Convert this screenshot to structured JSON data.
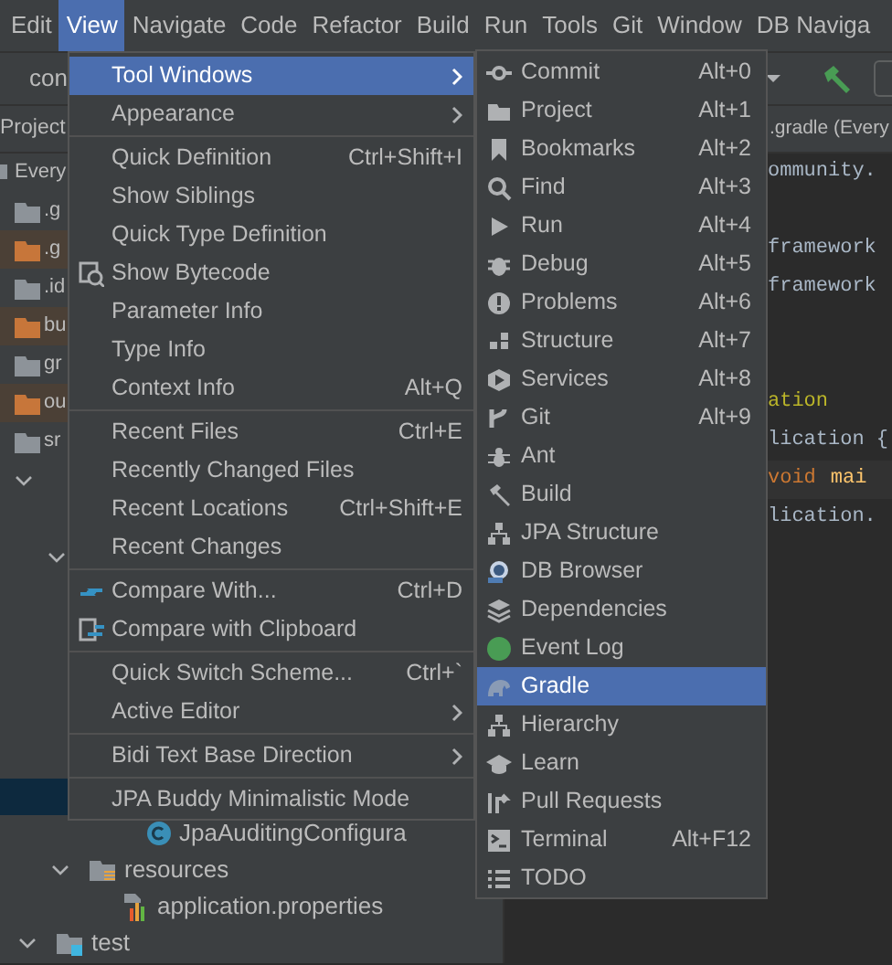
{
  "menubar": [
    {
      "label": "Edit",
      "selected": false
    },
    {
      "label": "View",
      "selected": true
    },
    {
      "label": "Navigate",
      "selected": false
    },
    {
      "label": "Code",
      "selected": false
    },
    {
      "label": "Refactor",
      "selected": false
    },
    {
      "label": "Build",
      "selected": false
    },
    {
      "label": "Run",
      "selected": false
    },
    {
      "label": "Tools",
      "selected": false
    },
    {
      "label": "Git",
      "selected": false
    },
    {
      "label": "Window",
      "selected": false
    },
    {
      "label": "DB Naviga",
      "selected": false
    }
  ],
  "breadcrumb": "con",
  "project_panel": {
    "title": "Project",
    "tree_top": [
      {
        "label": "Every",
        "kind": "module",
        "ignored": false
      },
      {
        "label": ".g",
        "kind": "folder",
        "ignored": false
      },
      {
        "label": ".g",
        "kind": "folder",
        "ignored": true
      },
      {
        "label": ".id",
        "kind": "folder",
        "ignored": false
      },
      {
        "label": "bu",
        "kind": "folder",
        "ignored": true
      },
      {
        "label": "gr",
        "kind": "folder",
        "ignored": false
      },
      {
        "label": "ou",
        "kind": "folder",
        "ignored": true
      },
      {
        "label": "sr",
        "kind": "folder",
        "ignored": false
      }
    ],
    "tree_bottom": [
      {
        "label": "JpaAuditingConfigura",
        "kind": "class"
      },
      {
        "label": "resources",
        "kind": "resources",
        "children": [
          {
            "label": "application.properties",
            "kind": "properties"
          }
        ]
      },
      {
        "label": "test",
        "kind": "test"
      }
    ]
  },
  "editor": {
    "tab": ".gradle (Every",
    "lines": [
      {
        "text": "ommunity.",
        "kind": "plain"
      },
      {
        "kind": "blank"
      },
      {
        "text": "framework",
        "kind": "plain"
      },
      {
        "text": "framework",
        "kind": "plain"
      },
      {
        "kind": "blank"
      },
      {
        "kind": "blank"
      },
      {
        "text": "ation",
        "kind": "annotation"
      },
      {
        "text": "lication {",
        "kind": "plain"
      },
      {
        "text": "void",
        "kind": "keyword",
        "rest": "mai"
      },
      {
        "text": "lication.",
        "kind": "plain"
      }
    ]
  },
  "view_menu": [
    {
      "kind": "submenu",
      "label": "Tool Windows",
      "selected": true
    },
    {
      "kind": "submenu",
      "label": "Appearance",
      "selected": false
    },
    {
      "kind": "separator"
    },
    {
      "kind": "item",
      "label": "Quick Definition",
      "shortcut": "Ctrl+Shift+I",
      "selected": false
    },
    {
      "kind": "item",
      "label": "Show Siblings",
      "selected": false
    },
    {
      "kind": "item",
      "label": "Quick Type Definition",
      "selected": false
    },
    {
      "kind": "item",
      "label": "Show Bytecode",
      "selected": false
    },
    {
      "kind": "item",
      "label": "Parameter Info",
      "selected": false
    },
    {
      "kind": "item",
      "label": "Type Info",
      "selected": false
    },
    {
      "kind": "item",
      "label": "Context Info",
      "shortcut": "Alt+Q",
      "selected": false
    },
    {
      "kind": "separator"
    },
    {
      "kind": "item",
      "label": "Recent Files",
      "shortcut": "Ctrl+E",
      "selected": false
    },
    {
      "kind": "item",
      "label": "Recently Changed Files",
      "selected": false
    },
    {
      "kind": "item",
      "label": "Recent Locations",
      "shortcut": "Ctrl+Shift+E",
      "selected": false
    },
    {
      "kind": "item",
      "label": "Recent Changes",
      "selected": false
    },
    {
      "kind": "separator"
    },
    {
      "kind": "item",
      "label": "Compare With...",
      "shortcut": "Ctrl+D",
      "selected": false
    },
    {
      "kind": "item",
      "label": "Compare with Clipboard",
      "selected": false
    },
    {
      "kind": "separator"
    },
    {
      "kind": "item",
      "label": "Quick Switch Scheme...",
      "shortcut": "Ctrl+`",
      "selected": false
    },
    {
      "kind": "submenu",
      "label": "Active Editor",
      "selected": false
    },
    {
      "kind": "separator"
    },
    {
      "kind": "submenu",
      "label": "Bidi Text Base Direction",
      "selected": false
    },
    {
      "kind": "separator"
    },
    {
      "kind": "item",
      "label": "JPA Buddy Minimalistic Mode",
      "selected": false
    }
  ],
  "tool_windows_menu": [
    {
      "label": "Commit",
      "shortcut": "Alt+0",
      "selected": false
    },
    {
      "label": "Project",
      "shortcut": "Alt+1",
      "selected": false
    },
    {
      "label": "Bookmarks",
      "shortcut": "Alt+2",
      "selected": false
    },
    {
      "label": "Find",
      "shortcut": "Alt+3",
      "selected": false
    },
    {
      "label": "Run",
      "shortcut": "Alt+4",
      "selected": false
    },
    {
      "label": "Debug",
      "shortcut": "Alt+5",
      "selected": false
    },
    {
      "label": "Problems",
      "shortcut": "Alt+6",
      "selected": false
    },
    {
      "label": "Structure",
      "shortcut": "Alt+7",
      "selected": false
    },
    {
      "label": "Services",
      "shortcut": "Alt+8",
      "selected": false
    },
    {
      "label": "Git",
      "shortcut": "Alt+9",
      "selected": false
    },
    {
      "label": "Ant",
      "selected": false
    },
    {
      "label": "Build",
      "selected": false
    },
    {
      "label": "JPA Structure",
      "selected": false
    },
    {
      "label": "DB Browser",
      "selected": false
    },
    {
      "label": "Dependencies",
      "selected": false
    },
    {
      "label": "Event Log",
      "selected": false
    },
    {
      "label": "Gradle",
      "selected": true
    },
    {
      "label": "Hierarchy",
      "selected": false
    },
    {
      "label": "Learn",
      "selected": false
    },
    {
      "label": "Pull Requests",
      "selected": false
    },
    {
      "label": "Terminal",
      "shortcut": "Alt+F12",
      "selected": false
    },
    {
      "label": "TODO",
      "selected": false
    }
  ]
}
